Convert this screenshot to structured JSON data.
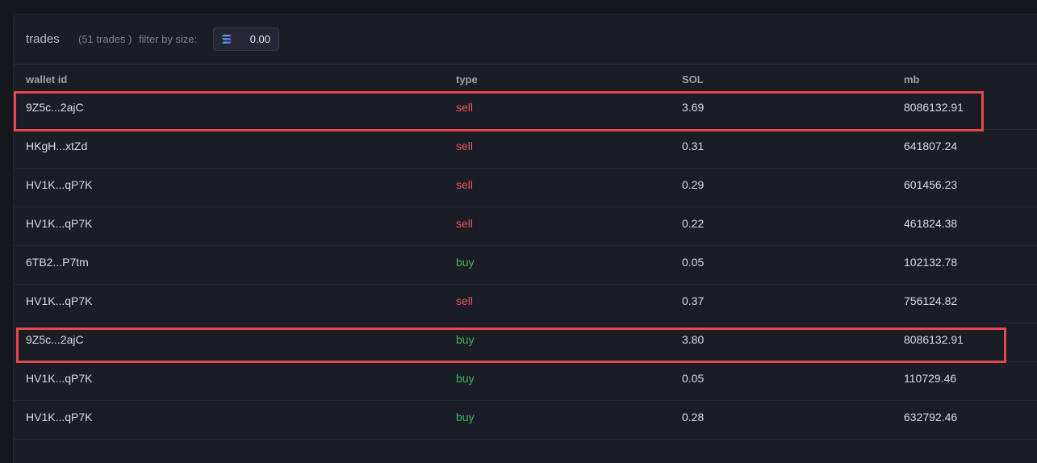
{
  "panel": {
    "title": "trades",
    "count_text": "(51 trades )",
    "filter_label": "filter by size:",
    "filter_value": "0.00",
    "filter_icon": "solana-icon"
  },
  "columns": {
    "wallet": "wallet id",
    "type": "type",
    "sol": "SOL",
    "mb": "mb"
  },
  "rows": [
    {
      "wallet": "9Z5c...2ajC",
      "type": "sell",
      "sol": "3.69",
      "mb": "8086132.91",
      "highlighted": true
    },
    {
      "wallet": "HKgH...xtZd",
      "type": "sell",
      "sol": "0.31",
      "mb": "641807.24",
      "highlighted": false
    },
    {
      "wallet": "HV1K...qP7K",
      "type": "sell",
      "sol": "0.29",
      "mb": "601456.23",
      "highlighted": false
    },
    {
      "wallet": "HV1K...qP7K",
      "type": "sell",
      "sol": "0.22",
      "mb": "461824.38",
      "highlighted": false
    },
    {
      "wallet": "6TB2...P7tm",
      "type": "buy",
      "sol": "0.05",
      "mb": "102132.78",
      "highlighted": false
    },
    {
      "wallet": "HV1K...qP7K",
      "type": "sell",
      "sol": "0.37",
      "mb": "756124.82",
      "highlighted": false
    },
    {
      "wallet": "9Z5c...2ajC",
      "type": "buy",
      "sol": "3.80",
      "mb": "8086132.91",
      "highlighted": true
    },
    {
      "wallet": "HV1K...qP7K",
      "type": "buy",
      "sol": "0.05",
      "mb": "110729.46",
      "highlighted": false
    },
    {
      "wallet": "HV1K...qP7K",
      "type": "buy",
      "sol": "0.28",
      "mb": "632792.46",
      "highlighted": false
    }
  ],
  "colors": {
    "sell": "#e5575a",
    "buy": "#3fb75a",
    "highlight_border": "#e5484d"
  }
}
